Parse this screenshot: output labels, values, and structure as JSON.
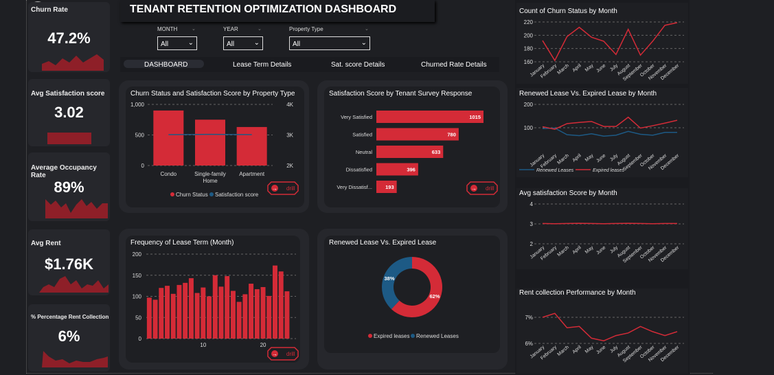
{
  "dashboard": {
    "title": "TENANT RETENTION OPTIMIZATION DASHBOARD"
  },
  "colors": {
    "accent": "#d42b37",
    "secondary": "#1d5a85",
    "panel": "#26272c",
    "card": "#1e1f23"
  },
  "kpis": [
    {
      "label": "Churn Rate",
      "value": "47.2%"
    },
    {
      "label": "Avg Satisfaction score",
      "value": "3.02"
    },
    {
      "label": "Average Occupancy Rate",
      "value": "89%"
    },
    {
      "label": "Avg Rent",
      "value": "$1.76K"
    },
    {
      "label": "% Percentage Rent Collection",
      "value": "6%"
    }
  ],
  "filters": [
    {
      "label": "MONTH",
      "value": "All"
    },
    {
      "label": "YEAR",
      "value": "All"
    },
    {
      "label": "Property Type",
      "value": "All"
    }
  ],
  "nav": {
    "tabs": [
      "DASHBOARD",
      "Lease Term Details",
      "Sat. score Details",
      "Churned Rate Details"
    ]
  },
  "drill_label": "drill",
  "chart_data": [
    {
      "type": "bar",
      "title": "Churn Status and Satisfaction Score by Property Type",
      "categories": [
        "Condo",
        "Single-family Home",
        "Apartment"
      ],
      "series": [
        {
          "name": "Churn Status",
          "values": [
            900,
            750,
            630
          ]
        },
        {
          "name": "Satisfaction score",
          "values": [
            3010,
            3020,
            3010
          ]
        }
      ],
      "y_ticks": [
        "1,000",
        "500",
        "0"
      ],
      "y2_ticks": [
        "4K",
        "3K",
        "2K"
      ],
      "ylim": [
        0,
        1000
      ],
      "y2lim": [
        2000,
        4000
      ],
      "legend": "bottom"
    },
    {
      "type": "bar",
      "title": "Satisfaction Score by Tenant Survey Response",
      "categories": [
        "Very Satisfied",
        "Satisfied",
        "Neutral",
        "Dissatisfied",
        "Very Dissatisf..."
      ],
      "values": [
        1015,
        780,
        633,
        396,
        193
      ]
    },
    {
      "type": "bar",
      "title": "Frequency of Lease Term (Month)",
      "x": [
        1,
        2,
        3,
        4,
        5,
        6,
        7,
        8,
        9,
        10,
        11,
        12,
        13,
        14,
        15,
        16,
        17,
        18,
        19,
        20,
        21,
        22,
        23,
        24,
        25
      ],
      "values": [
        97,
        92,
        120,
        125,
        106,
        127,
        132,
        143,
        108,
        121,
        100,
        150,
        123,
        148,
        113,
        87,
        105,
        130,
        117,
        122,
        101,
        173,
        159,
        112,
        0
      ],
      "x_ticks": [
        "10",
        "20"
      ],
      "y_ticks": [
        "200",
        "150",
        "100",
        "50",
        "0"
      ],
      "ylim": [
        0,
        200
      ]
    },
    {
      "type": "pie",
      "title": "Renewed Lease Vs. Expired Lease",
      "slices": [
        {
          "name": "Expired leases",
          "value": 62,
          "label": "62%"
        },
        {
          "name": "Renewed Leases",
          "value": 38,
          "label": "38%"
        }
      ],
      "legend": "bottom"
    },
    {
      "type": "line",
      "title": "Count of Churn Status by Month",
      "categories": [
        "January",
        "February",
        "March",
        "April",
        "May",
        "June",
        "July",
        "August",
        "September",
        "October",
        "November",
        "December"
      ],
      "values": [
        192,
        162,
        198,
        212,
        197,
        191,
        171,
        209,
        170,
        191,
        215,
        219
      ],
      "y_ticks": [
        "220",
        "200",
        "180",
        "160"
      ],
      "ylim": [
        160,
        220
      ]
    },
    {
      "type": "line",
      "title": "Renewed Lease Vs. Expired Lease by Month",
      "categories": [
        "January",
        "February",
        "March",
        "April",
        "May",
        "June",
        "July",
        "August",
        "September",
        "October",
        "November",
        "December"
      ],
      "series": [
        {
          "name": "Renewed Leases",
          "values": [
            98,
            100,
            72,
            68,
            76,
            66,
            70,
            86,
            74,
            70,
            82,
            82
          ]
        },
        {
          "name": "Expired leases",
          "values": [
            106,
            95,
            119,
            124,
            128,
            107,
            107,
            146,
            100,
            110,
            121,
            133
          ]
        }
      ],
      "y_ticks": [
        "200",
        "100"
      ],
      "ylim": [
        0,
        200
      ],
      "legend": "bottom"
    },
    {
      "type": "line",
      "title": "Avg satisfaction Score by Month",
      "categories": [
        "January",
        "February",
        "March",
        "April",
        "May",
        "June",
        "July",
        "August",
        "September",
        "October",
        "November",
        "December"
      ],
      "values": [
        3.02,
        3.01,
        3.02,
        3.03,
        3.02,
        3.01,
        3.02,
        3.03,
        3.02,
        3.01,
        3.02,
        3.02
      ],
      "y_ticks": [
        "4",
        "3",
        "2"
      ],
      "ylim": [
        2,
        4
      ]
    },
    {
      "type": "line",
      "title": "Rent collection Performance by Month",
      "categories": [
        "January",
        "February",
        "March",
        "April",
        "May",
        "June",
        "July",
        "August",
        "September",
        "October",
        "November",
        "December"
      ],
      "values": [
        7.0,
        7.15,
        6.6,
        6.65,
        6.2,
        6.1,
        6.3,
        6.4,
        6.65,
        6.45,
        6.3,
        6.45
      ],
      "y_ticks": [
        "7%",
        "6%"
      ],
      "ylim": [
        6,
        7
      ]
    }
  ]
}
